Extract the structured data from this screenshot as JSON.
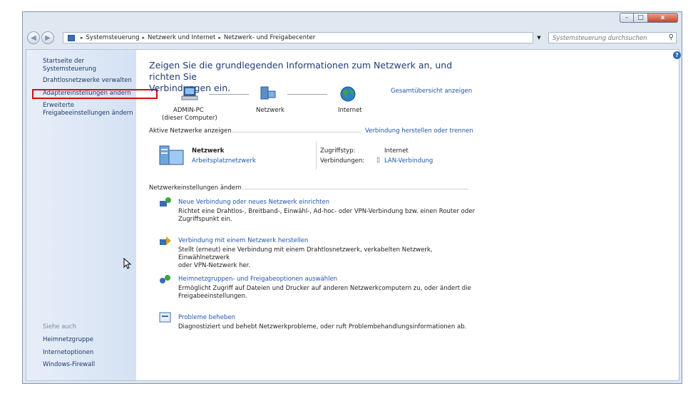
{
  "window": {
    "controls": {
      "minimize": "–",
      "maximize": "□",
      "close": "x"
    }
  },
  "address": {
    "back_glyph": "◀",
    "forward_glyph": "▶",
    "crumbs": [
      "Systemsteuerung",
      "Netzwerk und Internet",
      "Netzwerk- und Freigabecenter"
    ],
    "separator": "▸",
    "search_placeholder": "Systemsteuerung durchsuchen"
  },
  "sidebar": {
    "items": [
      "Startseite der Systemsteuerung",
      "Drahtlosnetzwerke verwalten",
      "Adaptereinstellungen ändern",
      "Erweiterte",
      "Freigabeeinstellungen ändern"
    ],
    "see_also_heading": "Siehe auch",
    "see_also": [
      "Heimnetzgruppe",
      "Internetoptionen",
      "Windows-Firewall"
    ]
  },
  "main": {
    "title_line1": "Zeigen Sie die grundlegenden Informationen zum Netzwerk an, und richten Sie",
    "title_line2": "Verbindungen ein.",
    "help_glyph": "?",
    "map": {
      "pc_name": "ADMIN-PC",
      "pc_sub": "(dieser Computer)",
      "network": "Netzwerk",
      "internet": "Internet",
      "overview_link": "Gesamtübersicht anzeigen"
    },
    "active": {
      "heading": "Aktive Netzwerke anzeigen",
      "connect_link": "Verbindung herstellen oder trennen",
      "network_name": "Netzwerk",
      "network_type": "Arbeitsplatznetzwerk",
      "access_label": "Zugriffstyp:",
      "access_value": "Internet",
      "conn_label": "Verbindungen:",
      "conn_value": "LAN-Verbindung"
    },
    "settings": {
      "heading": "Netzwerkeinstellungen ändern",
      "tasks": [
        {
          "title": "Neue Verbindung oder neues Netzwerk einrichten",
          "line1": "Richtet eine Drahtlos-, Breitband-, Einwähl-, Ad-hoc- oder VPN-Verbindung bzw. einen Router oder",
          "line2": "Zugriffspunkt ein."
        },
        {
          "title": "Verbindung mit einem Netzwerk herstellen",
          "line1": "Stellt (erneut) eine Verbindung mit einem Drahtlosnetzwerk, verkabelten Netzwerk, Einwählnetzwerk",
          "line2": "oder VPN-Netzwerk her."
        },
        {
          "title": "Heimnetzgruppen- und Freigabeoptionen auswählen",
          "line1": "Ermöglicht Zugriff auf Dateien und Drucker auf anderen Netzwerkcomputern zu, oder ändert die",
          "line2": "Freigabeeinstellungen."
        },
        {
          "title": "Probleme beheben",
          "line1": "Diagnostiziert und behebt Netzwerkprobleme, oder ruft Problembehandlungsinformationen ab.",
          "line2": ""
        }
      ]
    }
  },
  "colors": {
    "link": "#1f56b0",
    "title": "#1e3c73",
    "highlight": "#d40e15"
  }
}
